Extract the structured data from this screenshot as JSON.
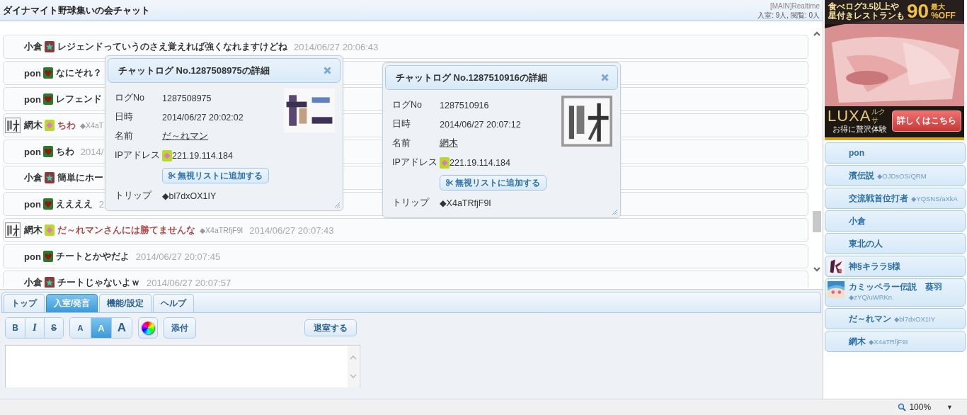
{
  "header": {
    "title": "ダイナマイト野球集いの会チャット",
    "mode": "[MAIN]Realtime",
    "stats": "入室: 9人, 閲覧: 0人"
  },
  "messages": [
    {
      "name": "小倉",
      "kind": "star",
      "avatar": false,
      "text": "レジェンドっていうのさえ覚えれば強くなれますけどね",
      "color": "#222222",
      "time": "2014/06/27 20:06:43"
    },
    {
      "name": "pon",
      "kind": "heart",
      "avatar": false,
      "text": "なにそれ？",
      "color": "#222222"
    },
    {
      "name": "pon",
      "kind": "heart",
      "avatar": false,
      "text": "レフェンド",
      "color": "#222222"
    },
    {
      "name": "網木",
      "kind": "diamond",
      "avatar": true,
      "text": "ちわ",
      "color": "#a83232",
      "trip": "◆X4aT"
    },
    {
      "name": "pon",
      "kind": "heart",
      "avatar": false,
      "text": "ちわ",
      "color": "#222222",
      "time": "2014/"
    },
    {
      "name": "小倉",
      "kind": "star",
      "avatar": false,
      "text": "簡単にホー",
      "color": "#222222"
    },
    {
      "name": "pon",
      "kind": "heart",
      "avatar": false,
      "text": "ええええ",
      "color": "#222222",
      "time": "2"
    },
    {
      "name": "網木",
      "kind": "diamond",
      "avatar": true,
      "text": "だ～れマンさんには勝てませんな",
      "color": "#a83232",
      "trip": "◆X4aTRfjF9I",
      "time": "2014/06/27 20:07:43"
    },
    {
      "name": "pon",
      "kind": "heart",
      "avatar": false,
      "text": "チートとかやだよ",
      "color": "#222222",
      "time": "2014/06/27 20:07:45"
    },
    {
      "name": "小倉",
      "kind": "star",
      "avatar": false,
      "text": "チートじゃないよｗ",
      "color": "#222222",
      "time": "2014/06/27 20:07:57"
    }
  ],
  "popups": [
    {
      "title": "チャットログ No.1287508975の詳細",
      "log_no_label": "ログNo",
      "log_no": "1287508975",
      "date_label": "日時",
      "date": "2014/06/27 20:02:02",
      "name_label": "名前",
      "name": "だ～れマン",
      "ip_label": "IPアドレス",
      "ip": {
        "kind": "diamond",
        "text": "221.19.114.184"
      },
      "ignore_button": "無視リストに追加する",
      "trip_label": "トリップ",
      "trip": "◆bl7dxOX1IY"
    },
    {
      "title": "チャットログ No.1287510916の詳細",
      "log_no_label": "ログNo",
      "log_no": "1287510916",
      "date_label": "日時",
      "date": "2014/06/27 20:07:12",
      "name_label": "名前",
      "name": "網木",
      "ip_label": "IPアドレス",
      "ip": {
        "kind": "diamond",
        "text": "221.19.114.184"
      },
      "ignore_button": "無視リストに追加する",
      "trip_label": "トリップ",
      "trip": "◆X4aTRfjF9I"
    }
  ],
  "tabs": [
    {
      "label": "トップ",
      "selected": false
    },
    {
      "label": "入室/発言",
      "selected": true
    },
    {
      "label": "機能/設定",
      "selected": false
    },
    {
      "label": "ヘルプ",
      "selected": false
    }
  ],
  "toolbar": {
    "style_buttons": [
      {
        "label": "B",
        "kind": "bold"
      },
      {
        "label": "I",
        "kind": "italic"
      },
      {
        "label": "S",
        "kind": "strike"
      }
    ],
    "size_buttons": [
      {
        "label": "A",
        "kind": "small",
        "selected": false
      },
      {
        "label": "A",
        "kind": "medium",
        "selected": true
      },
      {
        "label": "A",
        "kind": "large",
        "selected": false
      }
    ],
    "attach": "添付",
    "leave": "退室する"
  },
  "ad": {
    "line_1": "食べログ3.5以上や",
    "line_2": "星付きレストランも",
    "big": "90",
    "max": "最大",
    "off": "%OFF",
    "brand": "LUXA",
    "brand_reading": "ルクサ",
    "tagline": "お得に贅沢体験",
    "cta": "詳しくはこちら"
  },
  "users": [
    {
      "name": "pon",
      "avatar": false
    },
    {
      "name": "濱伝説",
      "trip": "◆OJDsOS/QRM",
      "avatar": false
    },
    {
      "name": "交流戦首位打者",
      "trip": "◆YQSNS/aXkA",
      "avatar": false
    },
    {
      "name": "小倉",
      "avatar": false
    },
    {
      "name": "東北の人",
      "avatar": false
    },
    {
      "name": "神§キララ§様",
      "avatar": true
    },
    {
      "name": "カミッペラー伝説　葵羽",
      "trip": "◆zYQ/uWRKn.",
      "avatar": true
    },
    {
      "name": "だ～れマン",
      "trip": "◆bl7dxOX1IY",
      "avatar": false
    },
    {
      "name": "網木",
      "trip": "◆X4aTRfjF9I",
      "avatar": false
    }
  ],
  "status_bar": {
    "zoom": "100%",
    "menu": "▼"
  }
}
